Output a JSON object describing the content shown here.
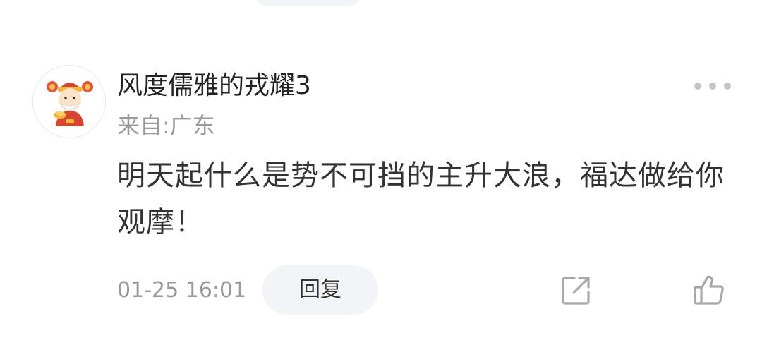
{
  "comment": {
    "username": "风度儒雅的戎耀3",
    "location": "来自:广东",
    "text": "明天起什么是势不可挡的主升大浪，福达做给你观摩！",
    "timestamp": "01-25 16:01",
    "reply_label": "回复"
  },
  "icons": {
    "avatar": "god-of-wealth-avatar",
    "more": "more-dots-icon",
    "share": "share-icon",
    "like": "thumbs-up-icon"
  },
  "colors": {
    "text_primary": "#222222",
    "text_secondary": "#9a9a9a",
    "button_bg": "#f3f4f6",
    "icon_gray": "#a8a8a8"
  }
}
